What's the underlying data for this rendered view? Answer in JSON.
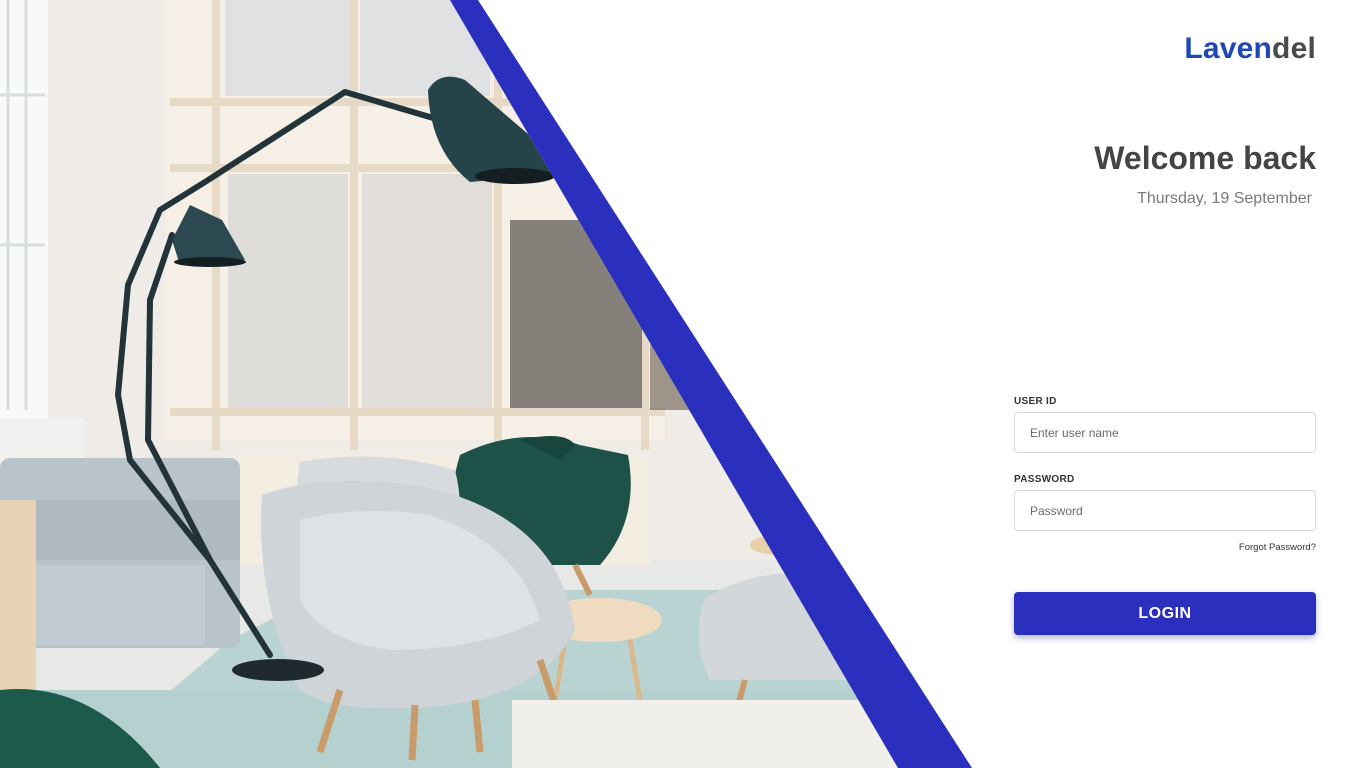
{
  "brand": {
    "part_a": "Laven",
    "part_b": "del"
  },
  "heading": {
    "title": "Welcome back",
    "date": "Thursday, 19 September"
  },
  "form": {
    "user_id": {
      "label": "USER ID",
      "placeholder": "Enter user name"
    },
    "password": {
      "label": "PASSWORD",
      "placeholder": "Password"
    },
    "forgot_password": "Forgot Password?",
    "login_label": "LOGIN"
  },
  "colors": {
    "accent": "#2a2fbd",
    "brand_blue": "#1f47b6",
    "text_dark": "#444444",
    "text_muted": "#7a7a7a"
  }
}
